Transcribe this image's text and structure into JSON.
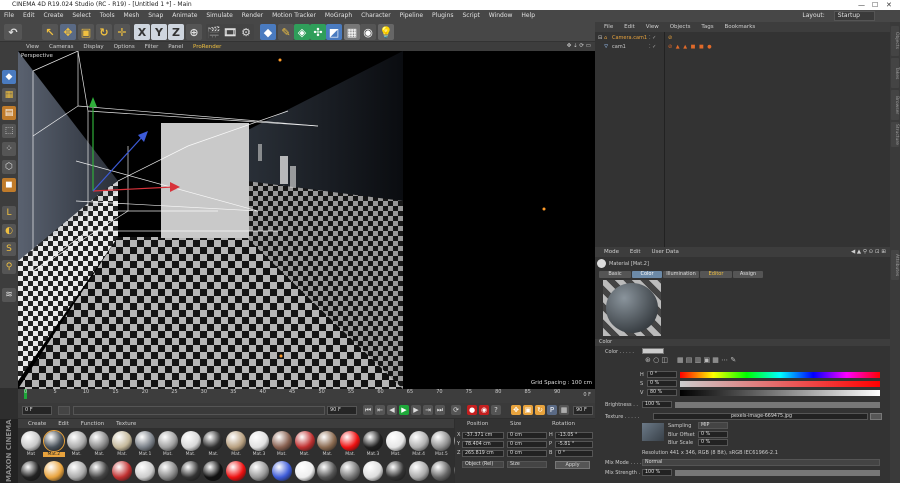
{
  "window": {
    "title": "CINEMA 4D R19.024 Studio (RC - R19) - [Untitled 1 *] - Main"
  },
  "menu": [
    "File",
    "Edit",
    "Create",
    "Select",
    "Tools",
    "Mesh",
    "Snap",
    "Animate",
    "Simulate",
    "Render",
    "Motion Tracker",
    "MoGraph",
    "Character",
    "Pipeline",
    "Plugins",
    "Script",
    "Window",
    "Help"
  ],
  "layout": {
    "label": "Layout:",
    "value": "Startup"
  },
  "toolbar": {
    "x_label": "X",
    "y_label": "Y",
    "z_label": "Z"
  },
  "viewport_menu": [
    "View",
    "Cameras",
    "Display",
    "Options",
    "Filter",
    "Panel",
    "ProRender"
  ],
  "viewport": {
    "name": "Perspective",
    "grid_spacing": "Grid Spacing : 100 cm"
  },
  "timeline": {
    "ticks": [
      "0",
      "5",
      "10",
      "15",
      "20",
      "25",
      "30",
      "35",
      "40",
      "45",
      "50",
      "55",
      "60",
      "65",
      "70",
      "75",
      "80",
      "85",
      "90"
    ],
    "end_frame": "0 F"
  },
  "transport": {
    "start": "0 F",
    "current": "0 F",
    "end": "90 F",
    "end2": "90 F"
  },
  "material_menu": [
    "Create",
    "Edit",
    "Function",
    "Texture"
  ],
  "materials_row1": [
    "Mat",
    "Mat.2",
    "Mat.",
    "Mat.",
    "Mat.",
    "Mat.1",
    "Mat.",
    "Mat.",
    "Mat.",
    "Mat.",
    "Mat.3",
    "Mat.",
    "Mat.",
    "Mat.",
    "Mat.",
    "Mat.3",
    "Mat.",
    "Mat.4",
    "Mat.5",
    "Mat.6"
  ],
  "maxon": {
    "text": "MAXON CINEMA 4D"
  },
  "coords": {
    "headers": {
      "position": "Position",
      "size": "Size",
      "rotation": "Rotation"
    },
    "rows": [
      {
        "axis": "X",
        "pos": "-37.371 cm",
        "size": "0 cm",
        "raxis": "H",
        "rot": "-13.05 °"
      },
      {
        "axis": "Y",
        "pos": "78.404 cm",
        "size": "0 cm",
        "raxis": "P",
        "rot": "-5.81 °"
      },
      {
        "axis": "Z",
        "pos": "265.819 cm",
        "size": "0 cm",
        "raxis": "B",
        "rot": "0 °"
      }
    ],
    "mode": "Object (Rel)",
    "size_mode": "Size",
    "apply": "Apply"
  },
  "object_menu": [
    "File",
    "Edit",
    "View",
    "Objects",
    "Tags",
    "Bookmarks"
  ],
  "objects": [
    {
      "name": "Camera.cam1"
    },
    {
      "name": "cam1"
    }
  ],
  "attr_menu": [
    "Mode",
    "Edit",
    "User Data"
  ],
  "attr": {
    "title": "Material [Mat.2]",
    "tabs": [
      "Basic",
      "Color",
      "Illumination",
      "Editor",
      "Assign"
    ],
    "section": "Color",
    "color_label": "Color . . . . .",
    "h": {
      "label": "H",
      "value": "0 °"
    },
    "s": {
      "label": "S",
      "value": "0 %"
    },
    "v": {
      "label": "V",
      "value": "80 %"
    },
    "brightness": {
      "label": "Brightness . .",
      "value": "100 %"
    },
    "texture": {
      "label": "Texture . . . . .",
      "file": "pexels-image-669475.jpg"
    },
    "sampling": {
      "label": "Sampling",
      "value": "MIP"
    },
    "blur_offset": {
      "label": "Blur Offset",
      "value": "0 %"
    },
    "blur_scale": {
      "label": "Blur Scale",
      "value": "0 %"
    },
    "resolution": "Resolution 441 x 346, RGB (8 Bit), sRGB IEC61966-2.1",
    "mix_mode": {
      "label": "Mix Mode . . . .",
      "value": "Normal"
    },
    "mix_strength": {
      "label": "Mix Strength .",
      "value": "100 %"
    }
  },
  "colors": {
    "accent": "#6c8aa8",
    "play": "#1fa83a",
    "record": "#c41f1f",
    "highlight": "#e8a33d"
  }
}
